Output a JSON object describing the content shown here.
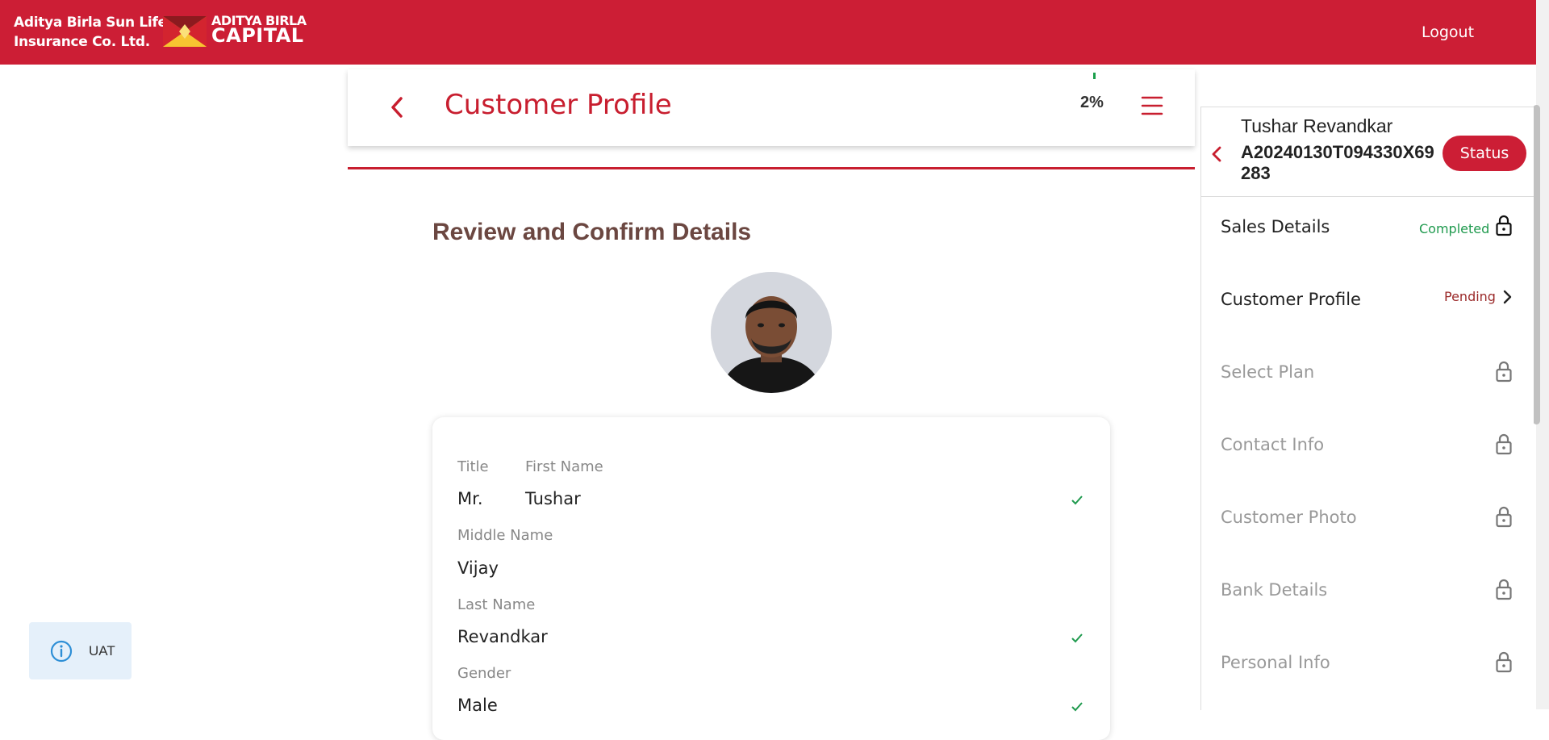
{
  "header": {
    "brand_line1": "Aditya Birla Sun Life",
    "brand_line2": "Insurance Co. Ltd.",
    "logo_line1": "ADITYA BIRLA",
    "logo_line2": "CAPITAL",
    "logout_label": "Logout",
    "brand_color": "#cc1e35"
  },
  "profile_header": {
    "title": "Customer Profile",
    "progress": "2%",
    "back_icon": "chevron-left-icon",
    "menu_icon": "hamburger-menu-icon"
  },
  "section": {
    "title": "Review and Confirm Details"
  },
  "form": {
    "title_label": "Title",
    "title_value": "Mr.",
    "first_name_label": "First Name",
    "first_name_value": "Tushar",
    "middle_name_label": "Middle Name",
    "middle_name_value": "Vijay",
    "last_name_label": "Last Name",
    "last_name_value": "Revandkar",
    "gender_label": "Gender",
    "gender_value": "Male"
  },
  "badge": {
    "label": "UAT",
    "icon": "info-icon"
  },
  "panel": {
    "customer_name": "Tushar Revandkar",
    "application_id": "A20240130T094330X69283",
    "status_label": "Status",
    "steps": [
      {
        "label": "Sales Details",
        "status": "Completed",
        "icon": "lock-icon"
      },
      {
        "label": "Customer Profile",
        "status": "Pending",
        "icon": "chevron-right-icon"
      },
      {
        "label": "Select Plan",
        "status": "",
        "icon": "lock-icon"
      },
      {
        "label": "Contact Info",
        "status": "",
        "icon": "lock-icon"
      },
      {
        "label": "Customer Photo",
        "status": "",
        "icon": "lock-icon"
      },
      {
        "label": "Bank Details",
        "status": "",
        "icon": "lock-icon"
      },
      {
        "label": "Personal Info",
        "status": "",
        "icon": "lock-icon"
      }
    ],
    "completed_color": "#1f9a4e",
    "pending_color": "#9b2a2a"
  }
}
